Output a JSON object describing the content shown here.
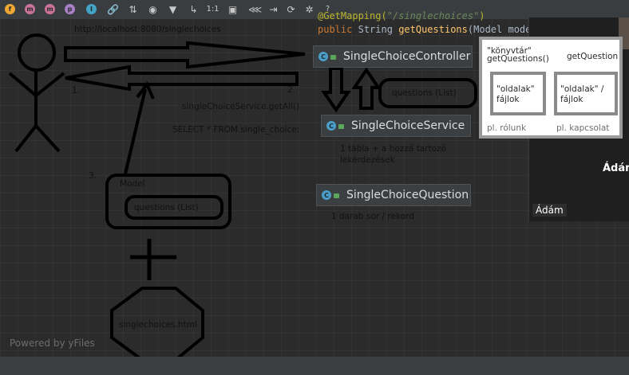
{
  "toolbar": {
    "items": [
      {
        "icon": "f-circle-icon",
        "letter": "f",
        "color": "#f0a732"
      },
      {
        "icon": "m-circle-icon",
        "letter": "m",
        "color": "#c9739b"
      },
      {
        "icon": "m-circle-icon",
        "letter": "m",
        "color": "#c9739b"
      },
      {
        "icon": "p-circle-icon",
        "letter": "p",
        "color": "#a77fc5"
      },
      {
        "icon": "i-circle-icon",
        "letter": "I",
        "color": "#43a3c4"
      },
      {
        "icon": "link-icon"
      },
      {
        "icon": "sort-icon"
      },
      {
        "icon": "eye-icon"
      },
      {
        "icon": "filter-icon"
      },
      {
        "icon": "edge-route-icon"
      },
      {
        "icon": "actual-size-icon",
        "text": "1:1"
      },
      {
        "icon": "fit-content-icon"
      },
      {
        "icon": "layout-icon"
      },
      {
        "icon": "export-icon"
      },
      {
        "icon": "refresh-icon"
      },
      {
        "icon": "settings-icon"
      },
      {
        "icon": "help-icon",
        "text": "?"
      }
    ]
  },
  "code": {
    "annotation": "@GetMapping(",
    "mapping_string": "\"/singlechoices\"",
    "annotation_close": ")",
    "modifier": "public",
    "return_type": "String",
    "method": "getQuestions",
    "params": "(Model model) {}"
  },
  "diagram": {
    "url": "http://localhost:8080/singlechoices",
    "step1": "1.",
    "step2": "2.",
    "step3": "3.",
    "service_call": "singleChoiceService.getAll()",
    "sql": "SELECT * FROM single_choice;",
    "service_note_line1": "1 tábla + a hozzá tartozó",
    "service_note_line2": "lekérdezések",
    "question_note": "1 darab sor / rekord",
    "questions_list_right": "questions (List)",
    "model_label": "Model",
    "questions_list_model": "questions (List)",
    "template_file": "singlechoices.html"
  },
  "nodes": {
    "controller": "SingleChoiceController",
    "service": "SingleChoiceService",
    "question": "SingleChoiceQuestion",
    "class_badge": "C"
  },
  "video": {
    "name_big": "Ádám",
    "name_tag": "Ádám"
  },
  "layers_card": {
    "lib_line1": "\"könyvtár\"",
    "lib_line2": "getQuestions()",
    "getq_cut": "getQuestion",
    "pages1_line1": "\"oldalak\"",
    "pages1_line2": "fájlok",
    "pages2_line1": "\"oldalak\" /",
    "pages2_line2": "fájlok",
    "example1": "pl. rólunk",
    "example2": "pl. kapcsolat"
  },
  "footer": {
    "powered_by": "Powered by yFiles"
  }
}
